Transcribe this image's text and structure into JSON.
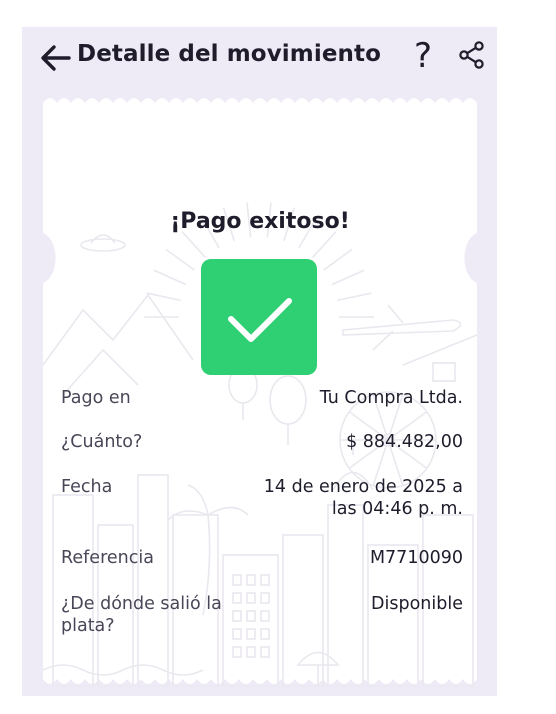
{
  "header": {
    "title": "Detalle del movimiento",
    "help_glyph": "?",
    "icons": [
      "back-arrow-icon",
      "help-icon",
      "share-icon"
    ]
  },
  "receipt": {
    "status_title": "¡Pago exitoso!",
    "status_icon": "check-icon",
    "status_color": "#2fcf74",
    "details": {
      "pago_en_label": "Pago en",
      "pago_en_value": "Tu Compra Ltda.",
      "cuanto_label": "¿Cuánto?",
      "cuanto_value": "$ 884.482,00",
      "fecha_label": "Fecha",
      "fecha_value_line1": "14 de enero de 2025 a",
      "fecha_value_line2": "las 04:46 p. m.",
      "referencia_label": "Referencia",
      "referencia_value": "M7710090",
      "origen_label_line1": "¿De dónde salió la",
      "origen_label_line2": "plata?",
      "origen_value": "Disponible"
    }
  },
  "colors": {
    "page_bg": "#eeeaf6",
    "ticket_bg": "#ffffff",
    "text_primary": "#1f1c2b",
    "illustration_stroke": "#e9e8ee"
  }
}
